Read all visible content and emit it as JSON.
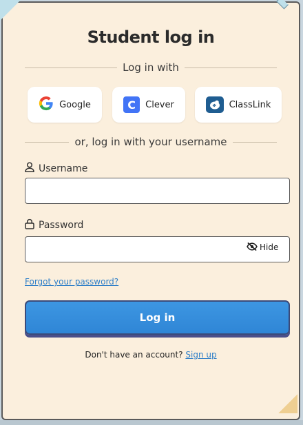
{
  "title": "Student log in",
  "sso": {
    "divider_label": "Log in with",
    "buttons": [
      {
        "label": "Google",
        "icon": "google-icon"
      },
      {
        "label": "Clever",
        "icon": "clever-icon"
      },
      {
        "label": "ClassLink",
        "icon": "classlink-icon"
      }
    ]
  },
  "username_divider": "or, log in with your username",
  "username": {
    "label": "Username",
    "value": "",
    "placeholder": ""
  },
  "password": {
    "label": "Password",
    "value": "",
    "placeholder": "",
    "toggle_label": "Hide"
  },
  "forgot_link": "Forgot your password?",
  "login_button": "Log in",
  "signup": {
    "prompt": "Don't have an account?",
    "link": "Sign up"
  },
  "colors": {
    "card_bg": "#fbefdd",
    "primary_button": "#3d96e2",
    "link": "#2f7fc8",
    "clever_brand": "#4274f6",
    "classlink_brand": "#1f5d91"
  }
}
